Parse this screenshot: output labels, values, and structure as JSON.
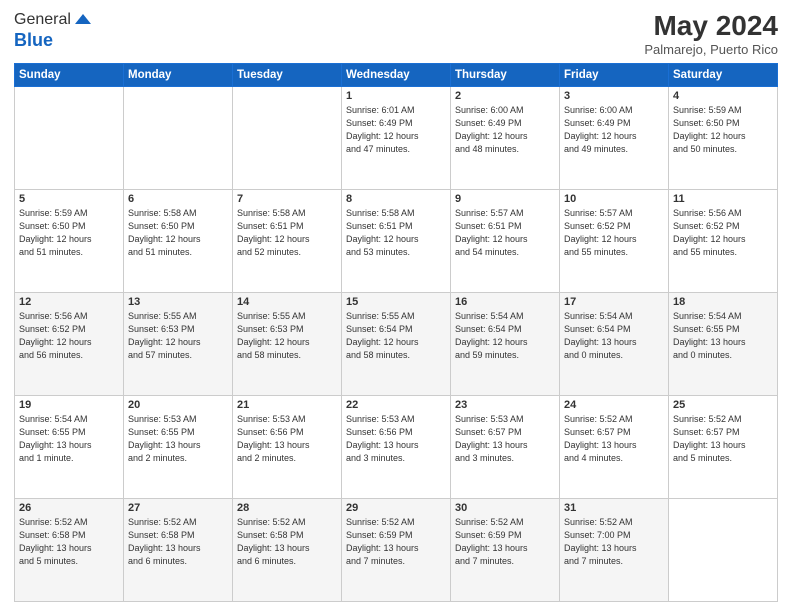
{
  "header": {
    "logo_line1": "General",
    "logo_line2": "Blue",
    "month_year": "May 2024",
    "location": "Palmarejo, Puerto Rico"
  },
  "days_of_week": [
    "Sunday",
    "Monday",
    "Tuesday",
    "Wednesday",
    "Thursday",
    "Friday",
    "Saturday"
  ],
  "weeks": [
    [
      {
        "day": "",
        "text": ""
      },
      {
        "day": "",
        "text": ""
      },
      {
        "day": "",
        "text": ""
      },
      {
        "day": "1",
        "text": "Sunrise: 6:01 AM\nSunset: 6:49 PM\nDaylight: 12 hours\nand 47 minutes."
      },
      {
        "day": "2",
        "text": "Sunrise: 6:00 AM\nSunset: 6:49 PM\nDaylight: 12 hours\nand 48 minutes."
      },
      {
        "day": "3",
        "text": "Sunrise: 6:00 AM\nSunset: 6:49 PM\nDaylight: 12 hours\nand 49 minutes."
      },
      {
        "day": "4",
        "text": "Sunrise: 5:59 AM\nSunset: 6:50 PM\nDaylight: 12 hours\nand 50 minutes."
      }
    ],
    [
      {
        "day": "5",
        "text": "Sunrise: 5:59 AM\nSunset: 6:50 PM\nDaylight: 12 hours\nand 51 minutes."
      },
      {
        "day": "6",
        "text": "Sunrise: 5:58 AM\nSunset: 6:50 PM\nDaylight: 12 hours\nand 51 minutes."
      },
      {
        "day": "7",
        "text": "Sunrise: 5:58 AM\nSunset: 6:51 PM\nDaylight: 12 hours\nand 52 minutes."
      },
      {
        "day": "8",
        "text": "Sunrise: 5:58 AM\nSunset: 6:51 PM\nDaylight: 12 hours\nand 53 minutes."
      },
      {
        "day": "9",
        "text": "Sunrise: 5:57 AM\nSunset: 6:51 PM\nDaylight: 12 hours\nand 54 minutes."
      },
      {
        "day": "10",
        "text": "Sunrise: 5:57 AM\nSunset: 6:52 PM\nDaylight: 12 hours\nand 55 minutes."
      },
      {
        "day": "11",
        "text": "Sunrise: 5:56 AM\nSunset: 6:52 PM\nDaylight: 12 hours\nand 55 minutes."
      }
    ],
    [
      {
        "day": "12",
        "text": "Sunrise: 5:56 AM\nSunset: 6:52 PM\nDaylight: 12 hours\nand 56 minutes."
      },
      {
        "day": "13",
        "text": "Sunrise: 5:55 AM\nSunset: 6:53 PM\nDaylight: 12 hours\nand 57 minutes."
      },
      {
        "day": "14",
        "text": "Sunrise: 5:55 AM\nSunset: 6:53 PM\nDaylight: 12 hours\nand 58 minutes."
      },
      {
        "day": "15",
        "text": "Sunrise: 5:55 AM\nSunset: 6:54 PM\nDaylight: 12 hours\nand 58 minutes."
      },
      {
        "day": "16",
        "text": "Sunrise: 5:54 AM\nSunset: 6:54 PM\nDaylight: 12 hours\nand 59 minutes."
      },
      {
        "day": "17",
        "text": "Sunrise: 5:54 AM\nSunset: 6:54 PM\nDaylight: 13 hours\nand 0 minutes."
      },
      {
        "day": "18",
        "text": "Sunrise: 5:54 AM\nSunset: 6:55 PM\nDaylight: 13 hours\nand 0 minutes."
      }
    ],
    [
      {
        "day": "19",
        "text": "Sunrise: 5:54 AM\nSunset: 6:55 PM\nDaylight: 13 hours\nand 1 minute."
      },
      {
        "day": "20",
        "text": "Sunrise: 5:53 AM\nSunset: 6:55 PM\nDaylight: 13 hours\nand 2 minutes."
      },
      {
        "day": "21",
        "text": "Sunrise: 5:53 AM\nSunset: 6:56 PM\nDaylight: 13 hours\nand 2 minutes."
      },
      {
        "day": "22",
        "text": "Sunrise: 5:53 AM\nSunset: 6:56 PM\nDaylight: 13 hours\nand 3 minutes."
      },
      {
        "day": "23",
        "text": "Sunrise: 5:53 AM\nSunset: 6:57 PM\nDaylight: 13 hours\nand 3 minutes."
      },
      {
        "day": "24",
        "text": "Sunrise: 5:52 AM\nSunset: 6:57 PM\nDaylight: 13 hours\nand 4 minutes."
      },
      {
        "day": "25",
        "text": "Sunrise: 5:52 AM\nSunset: 6:57 PM\nDaylight: 13 hours\nand 5 minutes."
      }
    ],
    [
      {
        "day": "26",
        "text": "Sunrise: 5:52 AM\nSunset: 6:58 PM\nDaylight: 13 hours\nand 5 minutes."
      },
      {
        "day": "27",
        "text": "Sunrise: 5:52 AM\nSunset: 6:58 PM\nDaylight: 13 hours\nand 6 minutes."
      },
      {
        "day": "28",
        "text": "Sunrise: 5:52 AM\nSunset: 6:58 PM\nDaylight: 13 hours\nand 6 minutes."
      },
      {
        "day": "29",
        "text": "Sunrise: 5:52 AM\nSunset: 6:59 PM\nDaylight: 13 hours\nand 7 minutes."
      },
      {
        "day": "30",
        "text": "Sunrise: 5:52 AM\nSunset: 6:59 PM\nDaylight: 13 hours\nand 7 minutes."
      },
      {
        "day": "31",
        "text": "Sunrise: 5:52 AM\nSunset: 7:00 PM\nDaylight: 13 hours\nand 7 minutes."
      },
      {
        "day": "",
        "text": ""
      }
    ]
  ]
}
